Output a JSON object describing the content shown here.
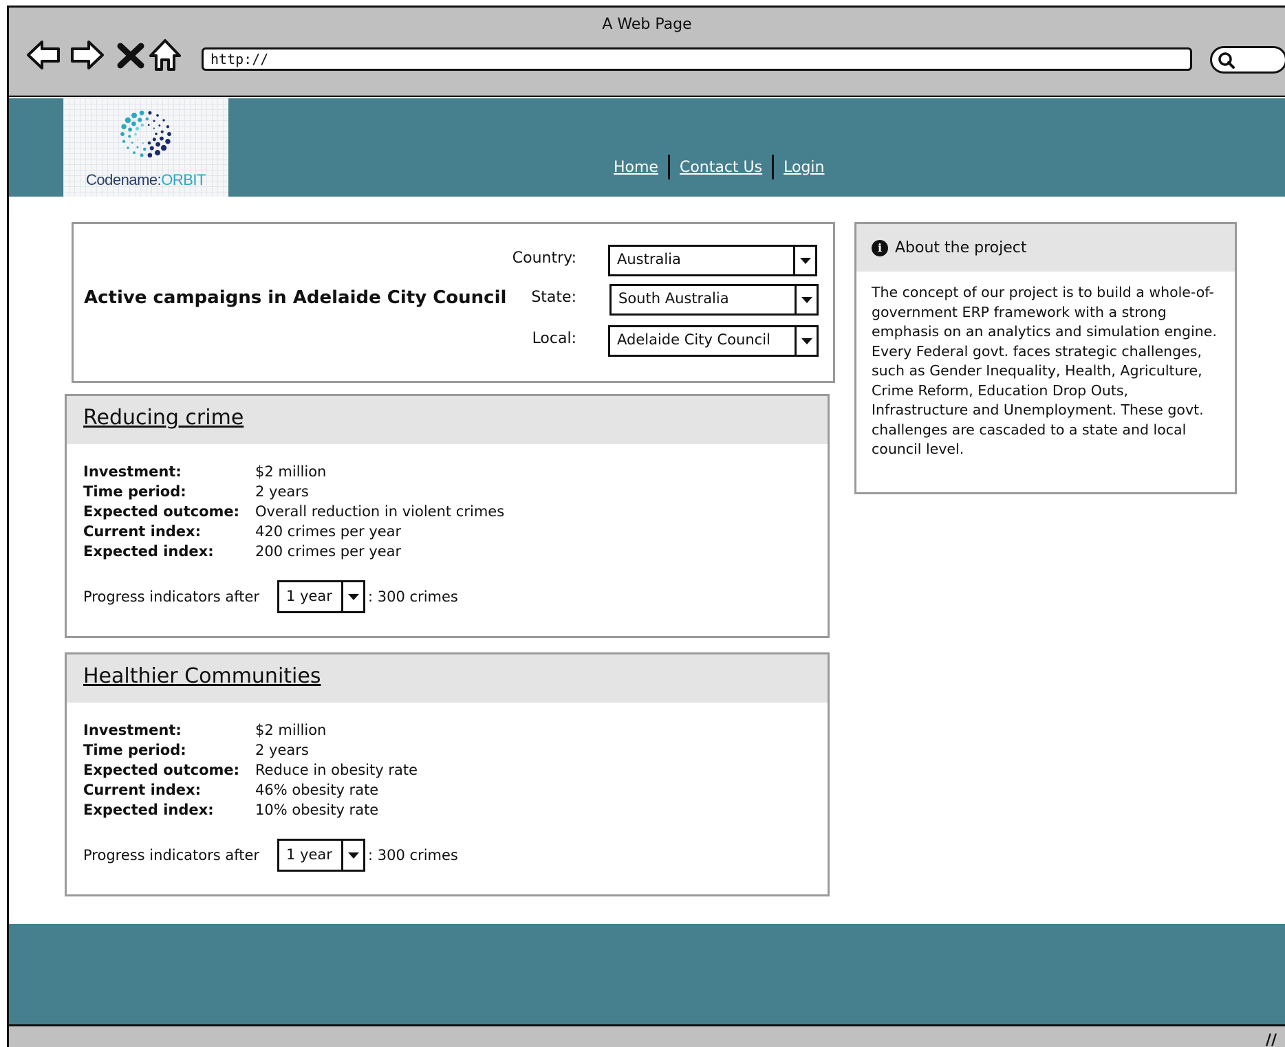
{
  "browser": {
    "window_title": "A Web Page",
    "url": "http://"
  },
  "site": {
    "logo_name": "Codename:",
    "logo_accent": "ORBIT",
    "nav": [
      "Home",
      "Contact Us",
      "Login"
    ]
  },
  "filters": {
    "heading": "Active campaigns in Adelaide City Council",
    "country_label": "Country:",
    "country_value": "Australia",
    "state_label": "State:",
    "state_value": "South Australia",
    "local_label": "Local:",
    "local_value": "Adelaide City Council"
  },
  "campaigns": [
    {
      "title": "Reducing crime",
      "fields": [
        {
          "k": "Investment:",
          "v": "$2 million"
        },
        {
          "k": "Time period:",
          "v": "2 years"
        },
        {
          "k": "Expected outcome:",
          "v": "Overall reduction in violent crimes"
        },
        {
          "k": "Current index:",
          "v": "420 crimes per year"
        },
        {
          "k": "Expected index:",
          "v": "200 crimes per year"
        }
      ],
      "progress_label": "Progress indicators after",
      "progress_period": "1 year",
      "progress_value": ": 300 crimes"
    },
    {
      "title": "Healthier Communities",
      "fields": [
        {
          "k": "Investment:",
          "v": "$2 million"
        },
        {
          "k": "Time period:",
          "v": "2 years"
        },
        {
          "k": "Expected outcome:",
          "v": "Reduce in obesity rate"
        },
        {
          "k": "Current index:",
          "v": "46% obesity rate"
        },
        {
          "k": "Expected index:",
          "v": "10% obesity rate"
        }
      ],
      "progress_label": "Progress indicators after",
      "progress_period": "1 year",
      "progress_value": ": 300 crimes"
    }
  ],
  "about": {
    "title": "About the project",
    "icon": "info-icon",
    "body": "The concept of our project is to build a whole-of-government ERP framework with a strong emphasis on an analytics and simulation engine. Every Federal govt. faces strategic challenges, such as Gender Inequality, Health, Agriculture, Crime Reform, Education Drop Outs, Infrastructure and Unemployment. These govt. challenges are cascaded to a state and local council level."
  },
  "colors": {
    "header_teal": "#467f8d",
    "chrome_gray": "#c0c0c0",
    "panel_head": "#e4e4e4"
  }
}
